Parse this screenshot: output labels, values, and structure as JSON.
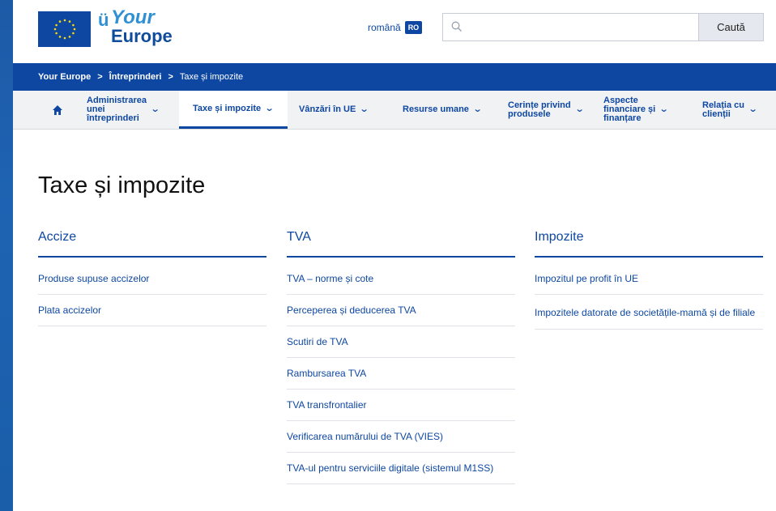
{
  "header": {
    "logo_line1": "Your",
    "logo_line2": "Europe",
    "language": "română",
    "language_code": "RO",
    "search_placeholder": "",
    "search_button": "Caută"
  },
  "breadcrumb": {
    "items": [
      "Your Europe",
      "Întreprinderi",
      "Taxe și impozite"
    ],
    "separator": ">"
  },
  "nav": {
    "items": [
      {
        "label": "Administrarea\nunei\nîntreprinderi"
      },
      {
        "label": "Taxe și impozite"
      },
      {
        "label": "Vânzări în UE"
      },
      {
        "label": "Resurse umane"
      },
      {
        "label": "Cerințe privind\nprodusele"
      },
      {
        "label": "Aspecte\nfinanciare și\nfinanțare"
      },
      {
        "label": "Relația cu\nclienții"
      }
    ]
  },
  "page_title": "Taxe și impozite",
  "columns": [
    {
      "heading": "Accize",
      "links": [
        "Produse supuse accizelor",
        "Plata accizelor"
      ]
    },
    {
      "heading": "TVA",
      "links": [
        "TVA – norme și cote",
        "Perceperea și deducerea TVA",
        "Scutiri de TVA",
        "Rambursarea TVA",
        "TVA transfrontalier",
        "Verificarea numărului de TVA (VIES)",
        "TVA-ul pentru serviciile digitale (sistemul M1SS)"
      ]
    },
    {
      "heading": "Impozite",
      "links": [
        "Impozitul pe profit în UE",
        "Impozitele datorate de societățile-mamă și de filiale"
      ]
    }
  ],
  "colors": {
    "brand_blue": "#0e47a1",
    "light_blue": "#2f90d3",
    "nav_bg": "#f1f2f4",
    "frame_bg": "#1d5aa6"
  }
}
